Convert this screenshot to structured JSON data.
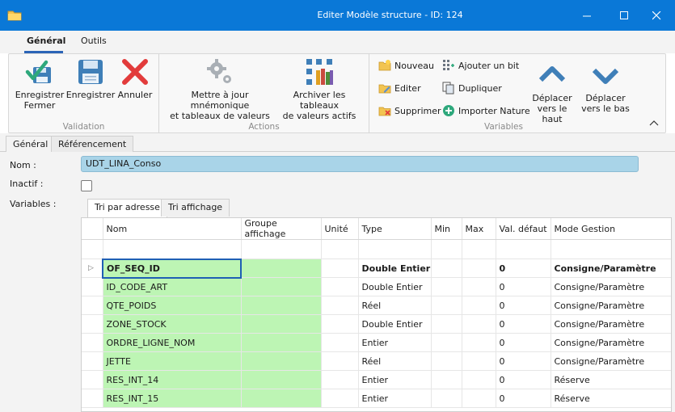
{
  "window": {
    "title": "Editer Modèle structure - ID: 124",
    "accent": "#0a78d7"
  },
  "menu": {
    "tabs": [
      {
        "label": "Général"
      },
      {
        "label": "Outils"
      }
    ]
  },
  "ribbon": {
    "groups": [
      {
        "label": "Validation"
      },
      {
        "label": "Actions"
      },
      {
        "label": "Variables"
      }
    ],
    "validation": {
      "save_close": [
        "Enregistrer",
        "Fermer"
      ],
      "save": "Enregistrer",
      "cancel": "Annuler"
    },
    "actions": {
      "update": [
        "Mettre à jour mnémonique",
        "et tableaux de valeurs"
      ],
      "archive": [
        "Archiver les tableaux",
        "de valeurs actifs"
      ]
    },
    "variables": {
      "new": "Nouveau",
      "edit": "Editer",
      "delete": "Supprimer",
      "add_bit": "Ajouter un bit",
      "duplicate": "Dupliquer",
      "import": "Importer Nature",
      "move_up": [
        "Déplacer",
        "vers le haut"
      ],
      "move_down": [
        "Déplacer",
        "vers le bas"
      ]
    }
  },
  "page_tabs": [
    {
      "label": "Général"
    },
    {
      "label": "Référencement"
    }
  ],
  "form": {
    "name_label": "Nom :",
    "name_value": "UDT_LINA_Conso",
    "inactive_label": "Inactif :",
    "variables_label": "Variables :"
  },
  "sort_tabs": [
    {
      "label": "Tri par adresse"
    },
    {
      "label": "Tri affichage"
    }
  ],
  "grid": {
    "columns": [
      "Nom",
      "Groupe affichage",
      "Unité",
      "Type",
      "Min",
      "Max",
      "Val. défaut",
      "Mode Gestion"
    ],
    "rows": [
      {
        "nom": "OF_SEQ_ID",
        "groupe": "",
        "unite": "",
        "type": "Double Entier",
        "min": "",
        "max": "",
        "val": "0",
        "mode": "Consigne/Paramètre"
      },
      {
        "nom": "ID_CODE_ART",
        "groupe": "",
        "unite": "",
        "type": "Double Entier",
        "min": "",
        "max": "",
        "val": "0",
        "mode": "Consigne/Paramètre"
      },
      {
        "nom": "QTE_POIDS",
        "groupe": "",
        "unite": "",
        "type": "Réel",
        "min": "",
        "max": "",
        "val": "0",
        "mode": "Consigne/Paramètre"
      },
      {
        "nom": "ZONE_STOCK",
        "groupe": "",
        "unite": "",
        "type": "Double Entier",
        "min": "",
        "max": "",
        "val": "0",
        "mode": "Consigne/Paramètre"
      },
      {
        "nom": "ORDRE_LIGNE_NOM",
        "groupe": "",
        "unite": "",
        "type": "Entier",
        "min": "",
        "max": "",
        "val": "0",
        "mode": "Consigne/Paramètre"
      },
      {
        "nom": "JETTE",
        "groupe": "",
        "unite": "",
        "type": "Réel",
        "min": "",
        "max": "",
        "val": "0",
        "mode": "Consigne/Paramètre"
      },
      {
        "nom": "RES_INT_14",
        "groupe": "",
        "unite": "",
        "type": "Entier",
        "min": "",
        "max": "",
        "val": "0",
        "mode": "Réserve"
      },
      {
        "nom": "RES_INT_15",
        "groupe": "",
        "unite": "",
        "type": "Entier",
        "min": "",
        "max": "",
        "val": "0",
        "mode": "Réserve"
      }
    ]
  }
}
